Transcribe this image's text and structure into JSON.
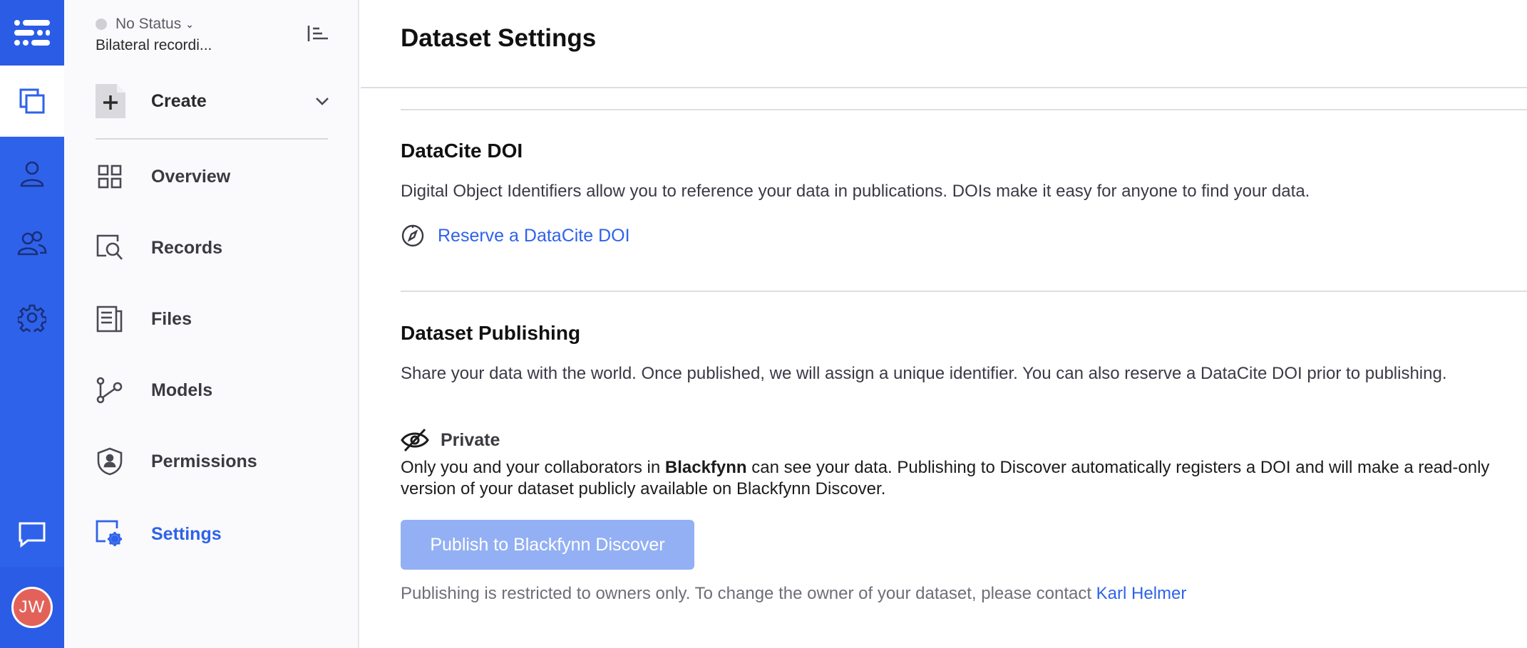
{
  "rail": {
    "avatar_initials": "JW",
    "accent": "#2f62ea",
    "items": [
      {
        "icon": "datasets-icon"
      },
      {
        "icon": "user-icon"
      },
      {
        "icon": "team-icon"
      },
      {
        "icon": "gear-icon"
      },
      {
        "icon": "chat-icon"
      }
    ]
  },
  "sidebar": {
    "status": "No Status",
    "dataset_name": "Bilateral recordi...",
    "create_label": "Create",
    "items": [
      {
        "label": "Overview",
        "icon": "grid-icon"
      },
      {
        "label": "Records",
        "icon": "records-search-icon"
      },
      {
        "label": "Files",
        "icon": "files-icon"
      },
      {
        "label": "Models",
        "icon": "models-graph-icon"
      },
      {
        "label": "Permissions",
        "icon": "shield-user-icon"
      },
      {
        "label": "Settings",
        "icon": "settings-icon",
        "active": true
      }
    ]
  },
  "main": {
    "title": "Dataset Settings",
    "doi": {
      "heading": "DataCite DOI",
      "description": "Digital Object Identifiers allow you to reference your data in publications. DOIs make it easy for anyone to find your data.",
      "reserve_link": "Reserve a DataCite DOI"
    },
    "publishing": {
      "heading": "Dataset Publishing",
      "description": "Share your data with the world. Once published, we will assign a unique identifier. You can also reserve a DataCite DOI prior to publishing.",
      "visibility": "Private",
      "private_desc_pre": "Only you and your collaborators in ",
      "private_desc_bold": "Blackfynn",
      "private_desc_post": " can see your data. Publishing to Discover automatically registers a DOI and will make a read-only version of your dataset publicly available on Blackfynn Discover.",
      "publish_button": "Publish to Blackfynn Discover",
      "restriction_text": "Publishing is restricted to owners only. To change the owner of your dataset, please contact ",
      "owner_name": "Karl Helmer"
    }
  }
}
